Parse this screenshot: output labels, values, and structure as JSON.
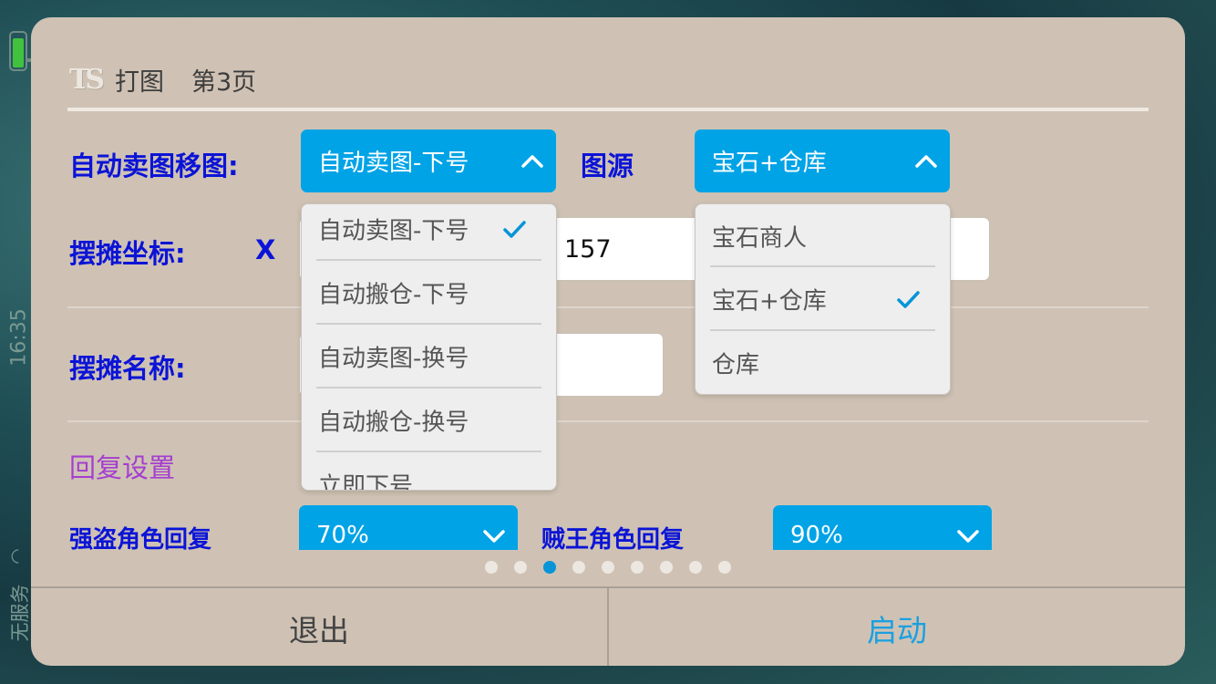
{
  "status_bar": {
    "time": "16:35",
    "carrier": "无服务"
  },
  "dialog": {
    "title": "打图",
    "page": "第3页",
    "auto_map_label": "自动卖图移图:",
    "auto_map_selected": "自动卖图-下号",
    "map_source_label": "图源",
    "map_source_selected": "宝石+仓库",
    "stall_coords_label": "摆摊坐标:",
    "x_label": "X",
    "x_value": "157",
    "stall_name_label": "摆摊名称:",
    "recovery_section": "回复设置",
    "robber_label": "强盗角色回复",
    "robber_value": "70%",
    "thief_king_label": "贼王角色回复",
    "thief_king_value": "90%"
  },
  "auto_map_options": [
    {
      "label": "自动卖图-下号",
      "checked": true
    },
    {
      "label": "自动搬仓-下号",
      "checked": false
    },
    {
      "label": "自动卖图-换号",
      "checked": false
    },
    {
      "label": "自动搬仓-换号",
      "checked": false
    },
    {
      "label": "立即下号",
      "checked": false
    }
  ],
  "map_source_options": [
    {
      "label": "宝石商人",
      "checked": false
    },
    {
      "label": "宝石+仓库",
      "checked": true
    },
    {
      "label": "仓库",
      "checked": false
    }
  ],
  "pagination": {
    "total": 9,
    "current": 3
  },
  "footer": {
    "exit": "退出",
    "start": "启动"
  },
  "colors": {
    "accent": "#00a3e6",
    "label_blue": "#0b14d6",
    "section_purple": "#a43ed0",
    "dialog_bg": "#cfc2b4"
  },
  "icons": {
    "select_open": "chevron-up-icon",
    "select_closed": "chevron-down-icon",
    "selected": "checkmark-icon"
  }
}
